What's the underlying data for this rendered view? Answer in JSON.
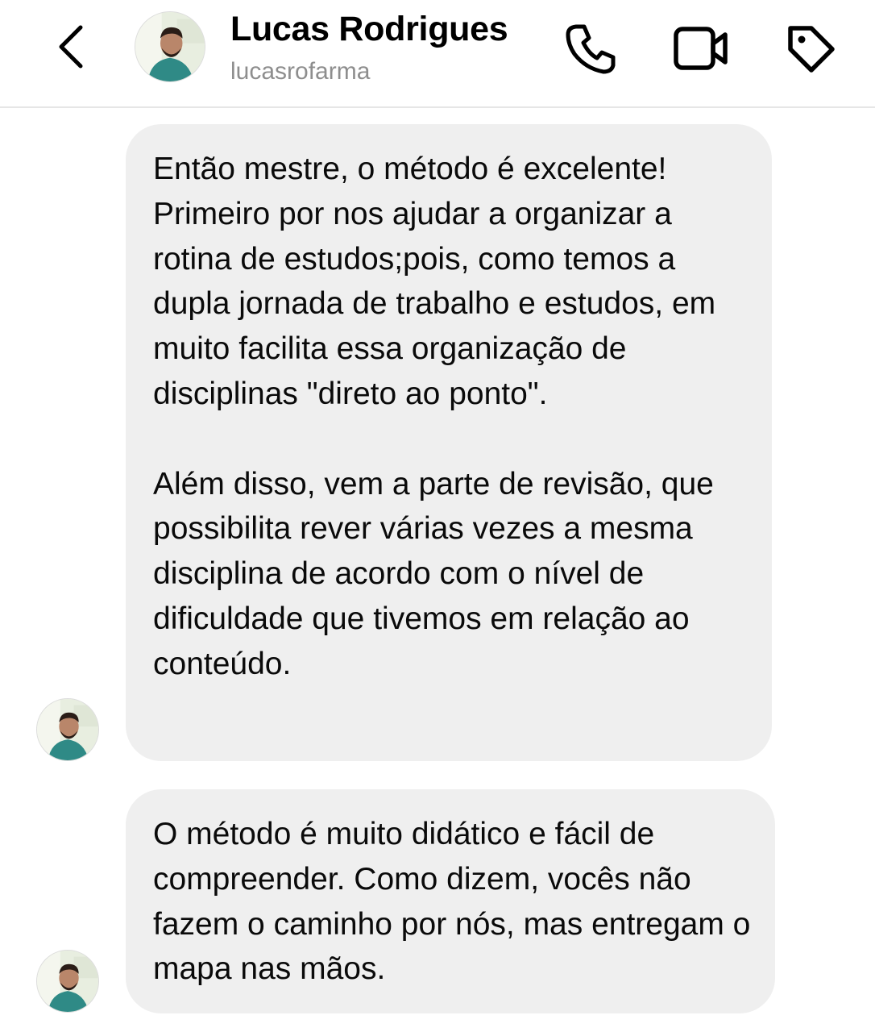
{
  "header": {
    "contact_name": "Lucas Rodrigues",
    "username": "lucasrofarma",
    "icons": {
      "back": "chevron-left-icon",
      "call": "phone-icon",
      "video": "video-camera-icon",
      "tag": "tag-icon"
    }
  },
  "messages": [
    {
      "text": "Então mestre, o método é excelente! Primeiro por nos ajudar a organizar a rotina de estudos;pois, como temos a dupla jornada de trabalho e estudos, em muito facilita essa organização de disciplinas \"direto ao ponto\".\n\nAlém disso, vem a parte de revisão, que possibilita rever várias vezes a mesma disciplina de acordo com o nível de dificuldade que tivemos em relação ao conteúdo."
    },
    {
      "text": "O método é muito didático e fácil de compreender. Como dizem, vocês não fazem o caminho por nós, mas entregam o mapa nas mãos."
    }
  ],
  "colors": {
    "bubble_background": "#efefef",
    "username_gray": "#8e8e8e",
    "divider": "#e6e6e6"
  }
}
